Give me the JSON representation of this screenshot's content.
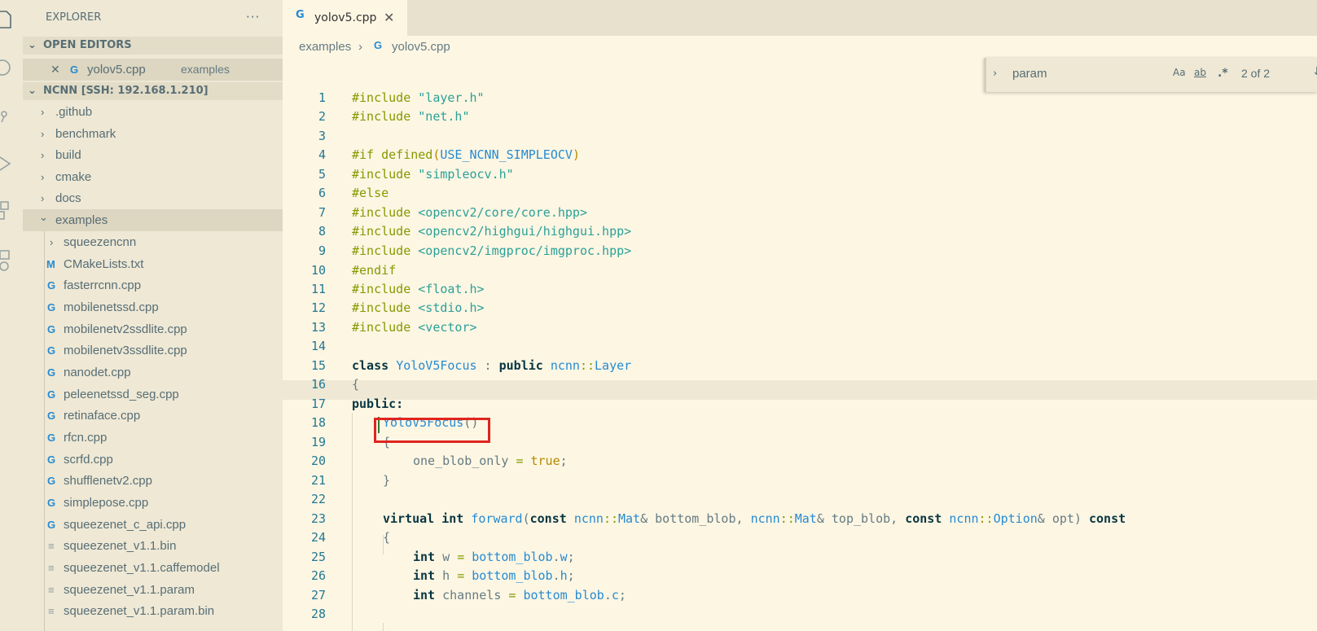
{
  "sidebar": {
    "title": "EXPLORER",
    "more": "···",
    "open_editors": {
      "label": "OPEN EDITORS",
      "items": [
        {
          "close": "✕",
          "icon": "G",
          "name": "yolov5.cpp",
          "folder": "examples"
        }
      ]
    },
    "workspace": {
      "label": "NCNN [SSH: 192.168.1.210]",
      "items": [
        {
          "name": ".github",
          "arrow": "›"
        },
        {
          "name": "benchmark",
          "arrow": "›"
        },
        {
          "name": "build",
          "arrow": "›"
        },
        {
          "name": "cmake",
          "arrow": "›"
        },
        {
          "name": "docs",
          "arrow": "›"
        },
        {
          "name": "examples",
          "arrow": "⌄"
        },
        {
          "name": "squeezencnn",
          "arrow": "›"
        },
        {
          "name": "CMakeLists.txt",
          "icon": "M"
        },
        {
          "name": "fasterrcnn.cpp",
          "icon": "G"
        },
        {
          "name": "mobilenetssd.cpp",
          "icon": "G"
        },
        {
          "name": "mobilenetv2ssdlite.cpp",
          "icon": "G"
        },
        {
          "name": "mobilenetv3ssdlite.cpp",
          "icon": "G"
        },
        {
          "name": "nanodet.cpp",
          "icon": "G"
        },
        {
          "name": "peleenetssd_seg.cpp",
          "icon": "G"
        },
        {
          "name": "retinaface.cpp",
          "icon": "G"
        },
        {
          "name": "rfcn.cpp",
          "icon": "G"
        },
        {
          "name": "scrfd.cpp",
          "icon": "G"
        },
        {
          "name": "shufflenetv2.cpp",
          "icon": "G"
        },
        {
          "name": "simplepose.cpp",
          "icon": "G"
        },
        {
          "name": "squeezenet_c_api.cpp",
          "icon": "G"
        },
        {
          "name": "squeezenet_v1.1.bin",
          "icon": "≡"
        },
        {
          "name": "squeezenet_v1.1.caffemodel",
          "icon": "≡"
        },
        {
          "name": "squeezenet_v1.1.param",
          "icon": "≡"
        },
        {
          "name": "squeezenet_v1.1.param.bin",
          "icon": "≡"
        }
      ]
    }
  },
  "tabs": [
    {
      "icon": "G",
      "label": "yolov5.cpp",
      "close": "✕"
    }
  ],
  "breadcrumb": {
    "folder": "examples",
    "sep": "›",
    "icon": "G",
    "file": "yolov5.cpp"
  },
  "find": {
    "chevron": "›",
    "query": "param",
    "match_case": "Aa",
    "whole_word": "ab",
    "regex": ".*",
    "count": "2 of 2",
    "next": "↓"
  },
  "editor": {
    "line_numbers": [
      "1",
      "2",
      "3",
      "4",
      "5",
      "6",
      "7",
      "8",
      "9",
      "10",
      "11",
      "12",
      "13",
      "14",
      "15",
      "16",
      "17",
      "18",
      "19",
      "20",
      "21",
      "22",
      "23",
      "24",
      "25",
      "26",
      "27",
      "28"
    ],
    "code": {
      "l1a": "#include ",
      "l1b": "\"layer.h\"",
      "l2a": "#include ",
      "l2b": "\"net.h\"",
      "l4a": "#if defined",
      "l4b": "(",
      "l4c": "USE_NCNN_SIMPLEOCV",
      "l4d": ")",
      "l5a": "#include ",
      "l5b": "\"simpleocv.h\"",
      "l6a": "#else",
      "l7a": "#include ",
      "l7b": "<opencv2/core/core.hpp>",
      "l8a": "#include ",
      "l8b": "<opencv2/highgui/highgui.hpp>",
      "l9a": "#include ",
      "l9b": "<opencv2/imgproc/imgproc.hpp>",
      "l10a": "#endif",
      "l11a": "#include ",
      "l11b": "<float.h>",
      "l12a": "#include ",
      "l12b": "<stdio.h>",
      "l13a": "#include ",
      "l13b": "<vector>",
      "l15a": "class ",
      "l15b": "YoloV5Focus",
      "l15c": " : ",
      "l15d": "public ",
      "l15e": "ncnn",
      "l15f": "::",
      "l15g": "Layer",
      "l16a": "{",
      "l17a": "public:",
      "l18a": "YoloV5Focus",
      "l18b": "()",
      "l19a": "{",
      "l20a": "one_blob_only ",
      "l20b": "= ",
      "l20c": "true",
      "l20d": ";",
      "l21a": "}",
      "l23a": "virtual ",
      "l23b": "int ",
      "l23c": "forward",
      "l23d": "(",
      "l23e": "const ",
      "l23f": "ncnn",
      "l23g": "::",
      "l23h": "Mat",
      "l23i": "& bottom_blob, ",
      "l23j": "ncnn",
      "l23k": "::",
      "l23l": "Mat",
      "l23m": "& top_blob, ",
      "l23n": "const ",
      "l23o": "ncnn",
      "l23p": "::",
      "l23q": "Option",
      "l23r": "& opt) ",
      "l23s": "const",
      "l24a": "{",
      "l25a": "int ",
      "l25b": "w ",
      "l25c": "= ",
      "l25d": "bottom_blob",
      "l25e": ".",
      "l25f": "w",
      "l25g": ";",
      "l26a": "int ",
      "l26b": "h ",
      "l26c": "= ",
      "l26d": "bottom_blob",
      "l26e": ".",
      "l26f": "h",
      "l26g": ";",
      "l27a": "int ",
      "l27b": "channels ",
      "l27c": "= ",
      "l27d": "bottom_blob",
      "l27e": ".",
      "l27f": "c",
      "l27g": ";"
    }
  },
  "colors": {
    "background": "#fdf6e3",
    "sidebar": "#eee8d5",
    "keyword": "#073642",
    "preprocessor": "#859900",
    "string": "#2aa198",
    "type": "#268bd2",
    "constant": "#b58900",
    "highlight_box": "#e0241f",
    "cursor": "#2e7d32"
  },
  "icons": [
    "files-icon",
    "search-icon",
    "source-control-icon",
    "run-debug-icon",
    "extensions-icon",
    "remote-explorer-icon"
  ]
}
